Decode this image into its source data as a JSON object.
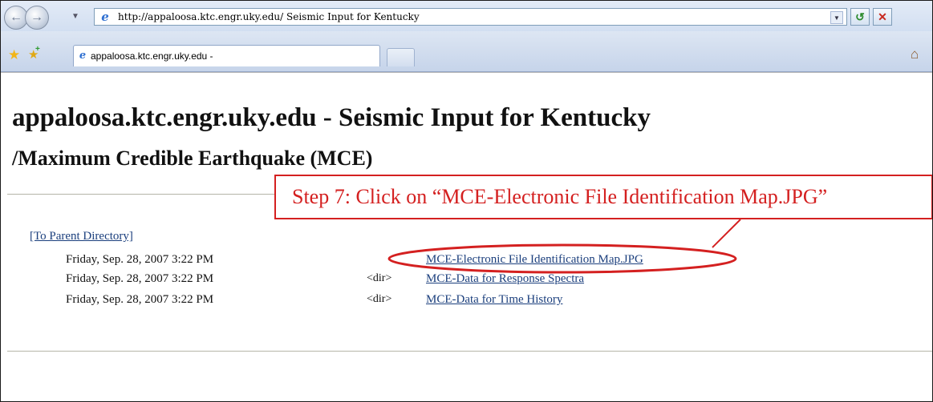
{
  "browser": {
    "address_url": "http://appaloosa.ktc.engr.uky.edu/ Seismic Input for Kentucky",
    "tab_title": "appaloosa.ktc.engr.uky.edu -",
    "icons": {
      "back": "back-arrow-icon",
      "forward": "forward-arrow-icon",
      "favorites": "star-icon",
      "add_favorite": "add-favorite-icon",
      "go": "refresh-go-icon",
      "stop": "stop-x-icon",
      "home": "home-icon"
    }
  },
  "page": {
    "heading_host": "appaloosa.ktc.engr.uky.edu",
    "heading_dash": " - ",
    "heading_title": "Seismic Input for Kentucky",
    "subheading": "/Maximum Credible Earthquake (MCE)",
    "parent_link": "[To Parent Directory]",
    "entries": [
      {
        "date": "Friday, Sep. 28, 2007 3:22 PM",
        "type": "",
        "name": "MCE-Electronic File Identification Map.JPG"
      },
      {
        "date": "Friday, Sep. 28, 2007 3:22 PM",
        "type": "<dir>",
        "name": "MCE-Data for Response Spectra"
      },
      {
        "date": "Friday, Sep. 28, 2007 3:22 PM",
        "type": "<dir>",
        "name": "MCE-Data for Time History"
      }
    ]
  },
  "annotation": {
    "text": "Step 7: Click on “MCE-Electronic File Identification Map.JPG”",
    "color": "#d42020"
  }
}
